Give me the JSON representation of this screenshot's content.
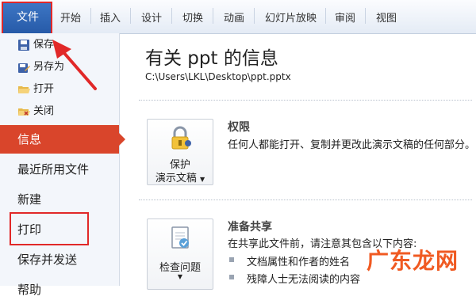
{
  "ribbon": {
    "file_tab": "文件",
    "tabs": [
      "开始",
      "插入",
      "设计",
      "切换",
      "动画",
      "幻灯片放映",
      "审阅",
      "视图"
    ]
  },
  "sidebar": {
    "commands": [
      {
        "label": "保存",
        "icon": "save-icon"
      },
      {
        "label": "另存为",
        "icon": "save-as-icon"
      },
      {
        "label": "打开",
        "icon": "open-folder-icon"
      },
      {
        "label": "关闭",
        "icon": "close-file-icon"
      }
    ],
    "nav": [
      {
        "label": "信息",
        "selected": true
      },
      {
        "label": "最近所用文件",
        "selected": false
      },
      {
        "label": "新建",
        "selected": false
      },
      {
        "label": "打印",
        "selected": false
      },
      {
        "label": "保存并发送",
        "selected": false
      },
      {
        "label": "帮助",
        "selected": false
      }
    ]
  },
  "main": {
    "title": "有关 ppt 的信息",
    "path": "C:\\Users\\LKL\\Desktop\\ppt.pptx",
    "permissions": {
      "button_line1": "保护",
      "button_line2": "演示文稿",
      "title": "权限",
      "desc": "任何人都能打开、复制并更改此演示文稿的任何部分。"
    },
    "prepare": {
      "button_label": "检查问题",
      "title": "准备共享",
      "desc": "在共享此文件前，请注意其包含以下内容:",
      "bullets": [
        "文档属性和作者的姓名",
        "残障人士无法阅读的内容"
      ]
    }
  },
  "watermark": "广东龙网",
  "colors": {
    "accent": "#d9452b",
    "file_tab": "#2b5fad",
    "highlight": "#e12828",
    "watermark": "#f05a22"
  }
}
